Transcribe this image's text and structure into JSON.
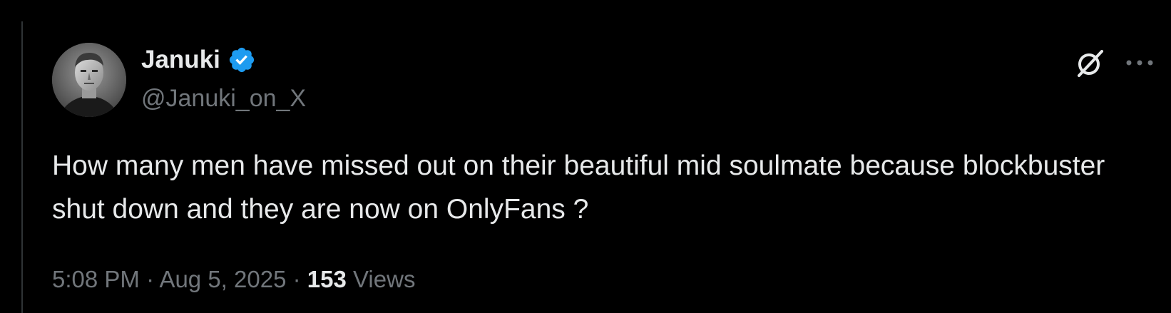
{
  "tweet": {
    "author": {
      "display_name": "Januki",
      "handle": "@Januki_on_X",
      "verified": true,
      "avatar_icon": "avatar-photo"
    },
    "text": "How many men have missed out on their beautiful mid soulmate because blockbuster shut down and they are now on OnlyFans ?",
    "time": "5:08 PM",
    "separator": "·",
    "date": "Aug 5, 2025",
    "views_count": "153",
    "views_label": "Views"
  },
  "icons": {
    "grok": "grok-icon",
    "more": "more-icon",
    "verified": "verified-badge-icon"
  },
  "colors": {
    "background": "#000000",
    "primary_text": "#e7e9ea",
    "secondary_text": "#71767b",
    "verified_blue": "#1d9bf0",
    "thread_line": "#2f3336"
  }
}
